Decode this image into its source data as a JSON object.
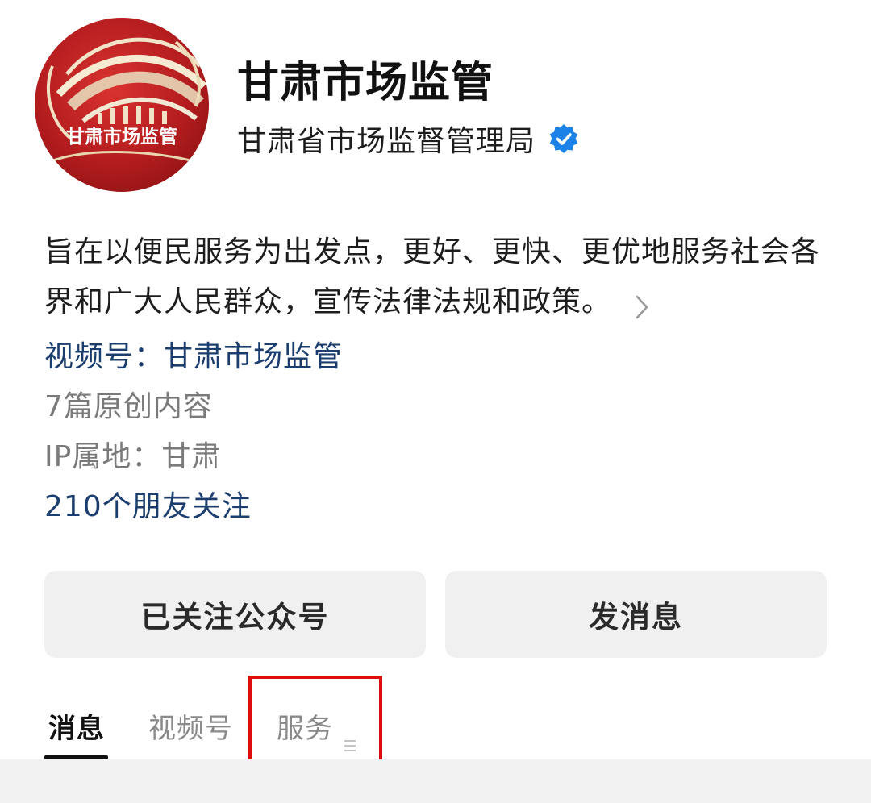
{
  "profile": {
    "account_name": "甘肃市场监管",
    "org_name": "甘肃省市场监督管理局",
    "avatar_logo_text": "甘肃市场监管",
    "verified_icon": "verified-badge-icon",
    "description_lines": [
      "旨在以便民服务为出发点，更好、更快、更优地服务社会各",
      "界和广大人民群众，宣传法律法规和政策。"
    ],
    "channels_link": "视频号：甘肃市场监管",
    "original_count": "7篇原创内容",
    "ip_location": "IP属地：甘肃",
    "friends_following": "210个朋友关注"
  },
  "actions": {
    "follow_label": "已关注公众号",
    "message_label": "发消息"
  },
  "tabs": [
    {
      "label": "消息",
      "active": true
    },
    {
      "label": "视频号",
      "active": false
    },
    {
      "label": "服务",
      "active": false,
      "icon": "menu-lines-icon"
    }
  ],
  "colors": {
    "link": "#1b3e6e",
    "secondary_text": "#7a7a7a",
    "verified": "#1d82e8",
    "avatar_red": "#b01a1c",
    "highlight_red": "#e00d0d",
    "button_bg": "#f0f0f0"
  }
}
